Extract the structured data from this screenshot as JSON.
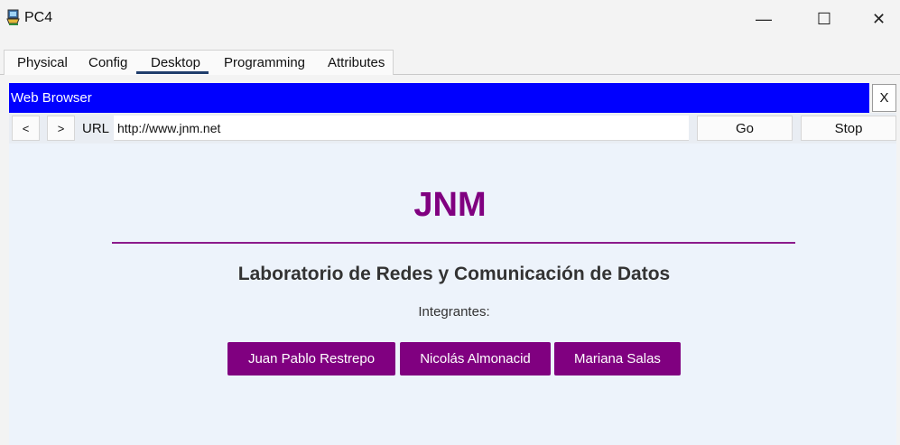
{
  "window": {
    "title": "PC4",
    "minimize": "—",
    "maximize": "☐",
    "close": "✕"
  },
  "tabs": [
    {
      "label": "Physical"
    },
    {
      "label": "Config"
    },
    {
      "label": "Desktop"
    },
    {
      "label": "Programming"
    },
    {
      "label": "Attributes"
    }
  ],
  "active_tab": "Desktop",
  "browser": {
    "title": "Web Browser",
    "close_label": "X",
    "back_label": "<",
    "forward_label": ">",
    "url_label": "URL",
    "url_value": "http://www.jnm.net",
    "go_label": "Go",
    "stop_label": "Stop"
  },
  "page": {
    "heading": "JNM",
    "subtitle": "Laboratorio de Redes y Comunicación de Datos",
    "members_label": "Integrantes:",
    "members": [
      "Juan Pablo Restrepo",
      "Nicolás Almonacid",
      "Mariana Salas"
    ]
  },
  "colors": {
    "browser_titlebar": "#0000ff",
    "accent_purple": "#800080",
    "active_tab_underline": "#1f3d6b"
  }
}
